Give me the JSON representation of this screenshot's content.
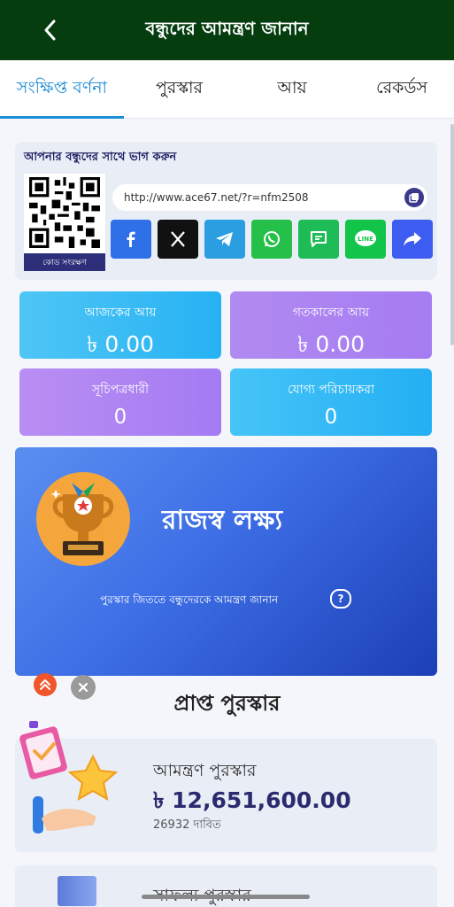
{
  "header": {
    "title": "বন্ধুদের আমন্ত্রণ জানান"
  },
  "tabs": [
    {
      "label": "সংক্ষিপ্ত বর্ণনা"
    },
    {
      "label": "পুরস্কার"
    },
    {
      "label": "আয়"
    },
    {
      "label": "রেকর্ডস"
    }
  ],
  "share": {
    "title": "আপনার বন্ধুদের সাথে ভাগ করুন",
    "qr_label": "কোড সংরক্ষণ",
    "link": "http://www.ace67.net/?r=nfm2508",
    "platforms": [
      "facebook-icon",
      "x-icon",
      "telegram-icon",
      "whatsapp-icon",
      "sms-icon",
      "line-icon",
      "share-icon"
    ]
  },
  "stats": {
    "today_label": "আজকের আয়",
    "today_value": "৳ 0.00",
    "yesterday_label": "গতকালের আয়",
    "yesterday_value": "৳ 0.00",
    "subscribers_label": "সূচিপত্রধারী",
    "subscribers_value": "0",
    "qualified_label": "যোগ্য পরিচায়করা",
    "qualified_value": "0"
  },
  "banner": {
    "title": "রাজস্ব লক্ষ্য",
    "subtitle": "পুরস্কার জিততে বন্ধুদেরকে আমন্ত্রণ জানান",
    "help": "?"
  },
  "rewards": {
    "section_title": "প্রাপ্ত পুরস্কার",
    "items": [
      {
        "name": "আমন্ত্রণ পুরস্কার",
        "amount": "৳ 12,651,600.00",
        "claims": "26932 দাবিত"
      },
      {
        "name": "সাফল্য পুরস্কার"
      }
    ]
  },
  "colors": {
    "header_bg": "#053d0f",
    "tab_active": "#1a8bd6",
    "banner_start": "#5a8ff0",
    "banner_end": "#1c3fb6"
  }
}
